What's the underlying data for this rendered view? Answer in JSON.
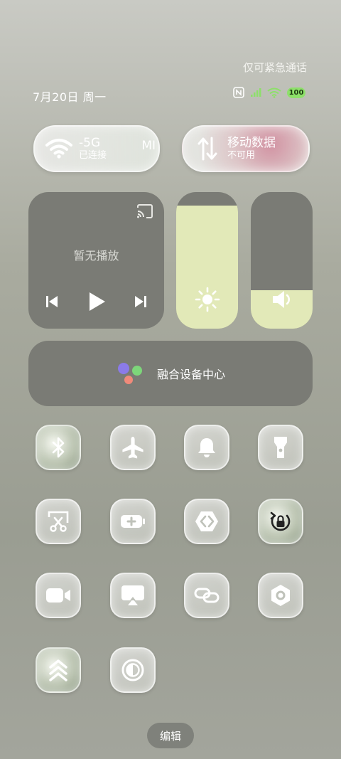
{
  "status_bar": {
    "emergency_text": "仅可紧急通话",
    "date": "7月20日 周一",
    "battery": "100",
    "icons": [
      "nfc-icon",
      "signal-icon",
      "wifi-icon",
      "battery-icon"
    ]
  },
  "wifi": {
    "title": "-5G",
    "subtitle": "已连接",
    "extra": "MI"
  },
  "mobile_data": {
    "title": "移动数据",
    "subtitle": "不可用"
  },
  "media": {
    "title": "暂无播放"
  },
  "sliders": {
    "brightness": 0.9,
    "volume": 0.28
  },
  "fusion": {
    "label": "融合设备中心"
  },
  "tiles": [
    {
      "icon": "bluetooth-icon",
      "active": true
    },
    {
      "icon": "airplane-icon",
      "active": false
    },
    {
      "icon": "bell-icon",
      "active": false
    },
    {
      "icon": "flashlight-icon",
      "active": false
    },
    {
      "icon": "screenshot-icon",
      "active": false
    },
    {
      "icon": "battery-saver-icon",
      "active": false
    },
    {
      "icon": "code-icon",
      "active": false
    },
    {
      "icon": "rotation-lock-icon",
      "active": true
    },
    {
      "icon": "video-icon",
      "active": false
    },
    {
      "icon": "screencast-icon",
      "active": false
    },
    {
      "icon": "link-icon",
      "active": false
    },
    {
      "icon": "settings-hex-icon",
      "active": false
    },
    {
      "icon": "chevrons-up-icon",
      "active": true
    },
    {
      "icon": "contrast-icon",
      "active": false
    }
  ],
  "edit_label": "编辑",
  "colors": {
    "slider_fill": "#e2e9b8",
    "panel": "#7a7b75",
    "battery": "#8de06a"
  }
}
